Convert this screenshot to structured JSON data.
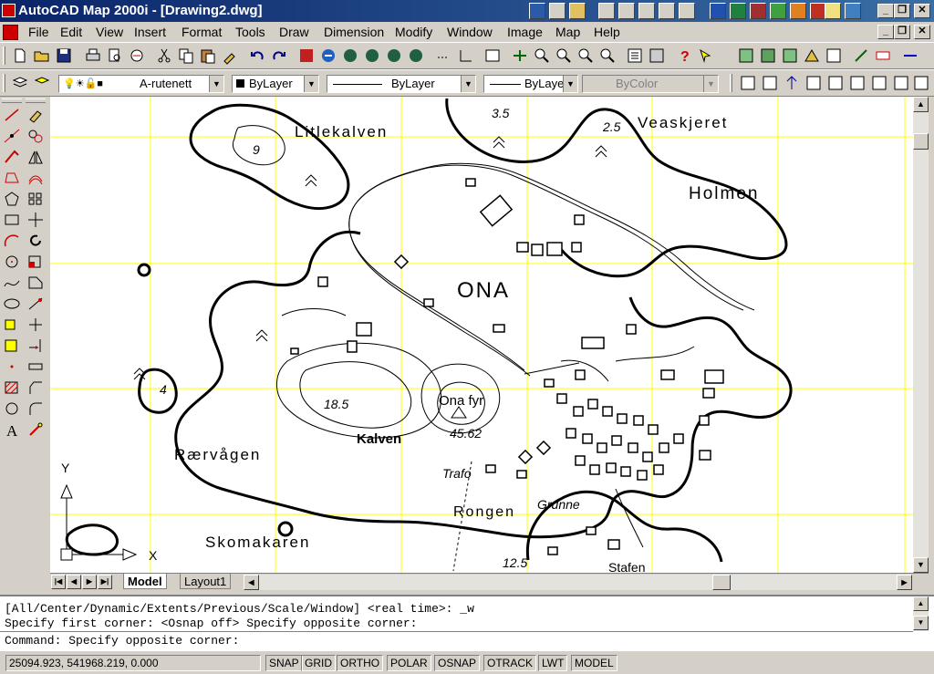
{
  "window": {
    "title": "AutoCAD Map 2000i - [Drawing2.dwg]",
    "controls": {
      "minimize": "_",
      "restore": "❐",
      "close": "✕"
    }
  },
  "menu": [
    "File",
    "Edit",
    "View",
    "Insert",
    "Format",
    "Tools",
    "Draw",
    "Dimension",
    "Modify",
    "Window",
    "Image",
    "Map",
    "Help"
  ],
  "layer_toolbar": {
    "layer_name": "A-rutenett",
    "color": "ByLayer",
    "linetype": "ByLayer",
    "lineweight": "ByLayer",
    "plotstyle": "ByColor"
  },
  "map": {
    "labels": {
      "litlekalven": "Litlekalven",
      "veaskjeret": "Veaskjeret",
      "holmen": "Holmen",
      "ona": "ONA",
      "ona_fyr": "Ona fyr",
      "kalven": "Kalven",
      "raervagen": "Rærvågen",
      "trafo": "Trafo",
      "rongen": "Rongen",
      "grunne": "Grunne",
      "skomakaren": "Skomakaren",
      "stafen": "Stafen"
    },
    "heights": {
      "h9": "9",
      "h3_5": "3.5",
      "h2_5": "2.5",
      "h18_5": "18.5",
      "h45_62": "45.62",
      "h4": "4",
      "h12_5": "12.5"
    },
    "ucs": {
      "x": "X",
      "y": "Y"
    }
  },
  "tabs": {
    "model": "Model",
    "layout1": "Layout1"
  },
  "command": {
    "line1": "[All/Center/Dynamic/Extents/Previous/Scale/Window] <real time>: _w",
    "line2": "Specify first corner:  <Osnap off> Specify opposite corner:",
    "line3": "Command: Specify opposite corner:"
  },
  "status": {
    "coords": "25094.923, 541968.219, 0.000",
    "toggles": [
      "SNAP",
      "GRID",
      "ORTHO",
      "POLAR",
      "OSNAP",
      "OTRACK",
      "LWT",
      "MODEL"
    ]
  },
  "colors": {
    "grid": "#ffff00",
    "titlebar": "#0a246a",
    "background": "#d4d0c8"
  }
}
